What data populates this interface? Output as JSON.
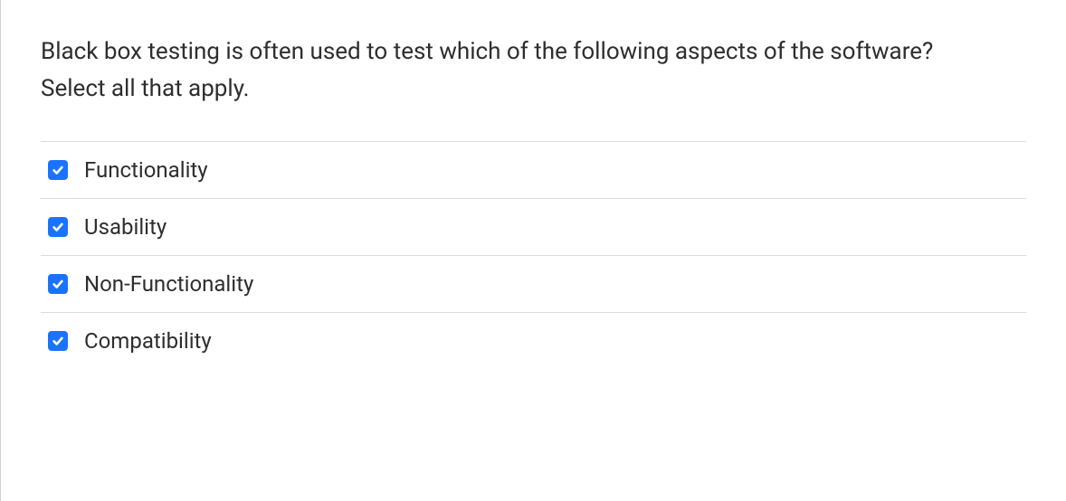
{
  "question": {
    "text": "Black box testing is often used to test which of the following aspects of the software?",
    "instruction": "Select all that apply."
  },
  "options": [
    {
      "label": "Functionality",
      "checked": true
    },
    {
      "label": "Usability",
      "checked": true
    },
    {
      "label": "Non-Functionality",
      "checked": true
    },
    {
      "label": "Compatibility",
      "checked": true
    }
  ]
}
